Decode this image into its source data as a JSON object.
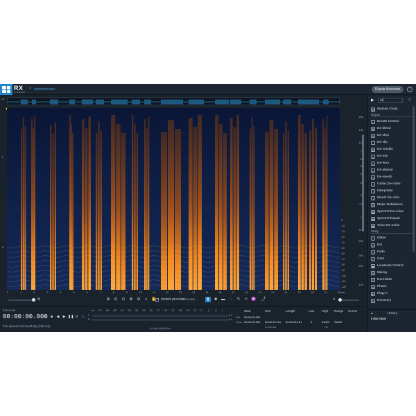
{
  "app": {
    "name": "RX",
    "subtitle": "STANDARD",
    "file_tab": "Interview.wav",
    "tab_close": "×",
    "repair_assistant": "Repair Assistant",
    "help": "?"
  },
  "spectrogram": {
    "amp_left": "L",
    "amp_right": "R",
    "freq_ticks": [
      "20k",
      "15k",
      "10k",
      "7k",
      "6k",
      "5k",
      "4k",
      "3k",
      "2k",
      "1.5k",
      "1k",
      "700",
      "500",
      "300",
      "200",
      "100"
    ],
    "db_ticks": [
      "5",
      "-10",
      "-20",
      "-30",
      "-40",
      "-50",
      "-60",
      "-70",
      "-80",
      "-90",
      "-100",
      "-110",
      "-120"
    ],
    "time_ticks": [
      "0",
      "1",
      "2",
      "3",
      "4",
      "5",
      "6",
      "7",
      "8",
      "9",
      "10",
      "11",
      "12",
      "13",
      "14",
      "15",
      "16",
      "17",
      "18",
      "19",
      "20",
      "21",
      "22",
      "23",
      "24",
      "25"
    ],
    "time_unit": "sec"
  },
  "toolbar": {
    "instant_process": "Instant process",
    "instant_mode": "Attenuate"
  },
  "bottom": {
    "time_format": "h:m:s.ms",
    "time_display": "00:00:00.000",
    "status": "File opened successfully (125 ms)",
    "meter_labels": [
      "-Inf.",
      "-70",
      "-60",
      "-48",
      "-42",
      "-39",
      "-36",
      "-33",
      "-30",
      "-27",
      "-24",
      "-21",
      "-18",
      "-15",
      "-12",
      "-9",
      "-6",
      "-3",
      "0"
    ],
    "meter_ch_L": "L",
    "meter_ch_R": "R",
    "meter_val_L": "-0.5",
    "meter_val_R": "-0.9",
    "bit_info": "24-bit | 48000 Hz",
    "sel": {
      "headers": [
        "Start",
        "End",
        "Length",
        "Low",
        "High",
        "Range",
        "Cursor"
      ],
      "sel_label": "Sel",
      "view_label": "View",
      "sel_start": "00:00:00.000",
      "view_start": "00:00:00.000",
      "view_end": "00:00:25.181",
      "view_length": "00:00:25.181",
      "low": "0",
      "high": "24000",
      "range": "24000",
      "time_format": "h:m:s.ms",
      "freq_unit": "Hz"
    }
  },
  "modules": {
    "filter": "All",
    "module_chain": "Module Chain",
    "repair_header": "Repair",
    "repair": [
      "Breath Control",
      "De-bleed",
      "De-click",
      "De-clip",
      "De-crackle",
      "De-ess",
      "De-hum",
      "De-plosive",
      "De-reverb",
      "Guitar De-noise",
      "Interpolate",
      "Mouth De-click",
      "Music Rebalance",
      "Spectral De-noise",
      "Spectral Repair",
      "Voice De-noise"
    ],
    "utility_header": "Utility",
    "utility": [
      "Dither",
      "EQ",
      "Fade",
      "Gain",
      "Loudness Control",
      "Mixing",
      "Normalize",
      "Phase",
      "Plug-in",
      "Recovery"
    ]
  },
  "history": {
    "title": "History",
    "item": "Initial State"
  }
}
